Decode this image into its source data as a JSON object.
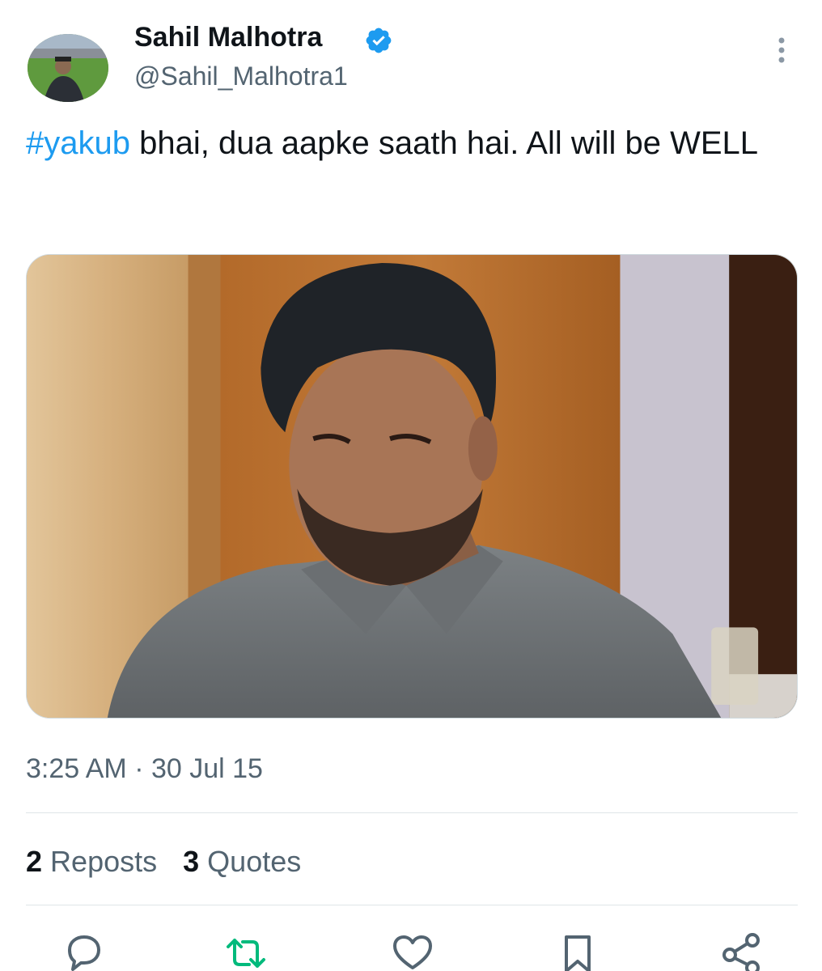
{
  "author": {
    "display_name": "Sahil Malhotra",
    "handle": "@Sahil_Malhotra1",
    "verified": true,
    "avatar_icon": "profile-photo"
  },
  "tweet": {
    "hashtag": "#yakub",
    "text": " bhai, dua aapke saath hai. All will be WELL",
    "timestamp": "3:25 AM · 30 Jul 15"
  },
  "media": {
    "icon": "man-photo"
  },
  "stats": {
    "reposts_count": "2",
    "reposts_label": "Reposts",
    "quotes_count": "3",
    "quotes_label": "Quotes"
  },
  "actions": [
    {
      "icon": "reply-icon"
    },
    {
      "icon": "repost-icon"
    },
    {
      "icon": "like-icon"
    },
    {
      "icon": "bookmark-icon"
    },
    {
      "icon": "share-icon"
    }
  ],
  "colors": {
    "link": "#1d9bf0",
    "repost": "#00ba7c",
    "muted": "#536471",
    "text": "#0f1419"
  }
}
